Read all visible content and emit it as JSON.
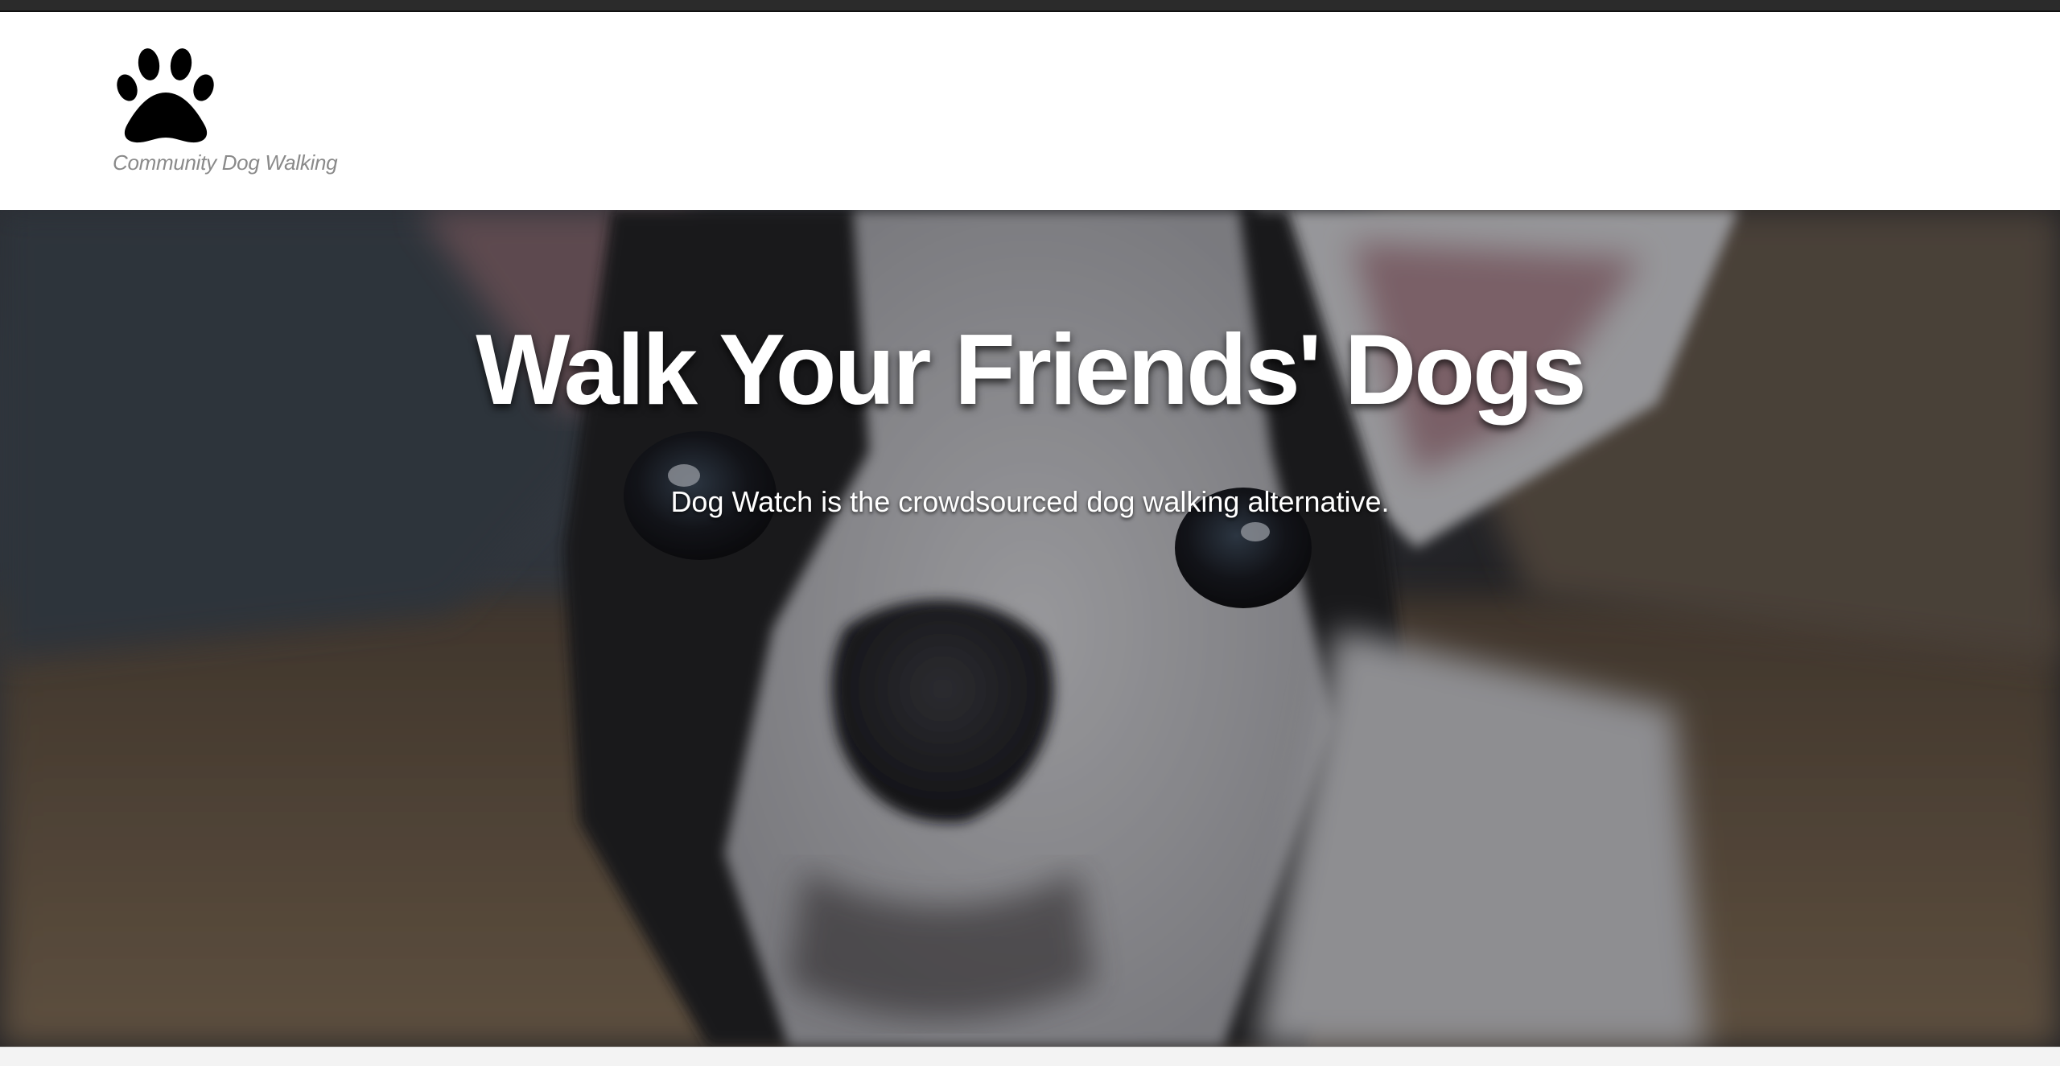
{
  "brand": {
    "logo_icon": "paw-print-icon",
    "tagline": "Community Dog Walking"
  },
  "hero": {
    "title": "Walk Your Friends' Dogs",
    "subtitle": "Dog Watch is the crowdsourced dog walking alternative.",
    "background": "photo of a black-and-white French bulldog puppy"
  },
  "colors": {
    "tagline": "#8a8a8a",
    "hero_text": "#ffffff",
    "top_strip": "#2b2b2b"
  }
}
